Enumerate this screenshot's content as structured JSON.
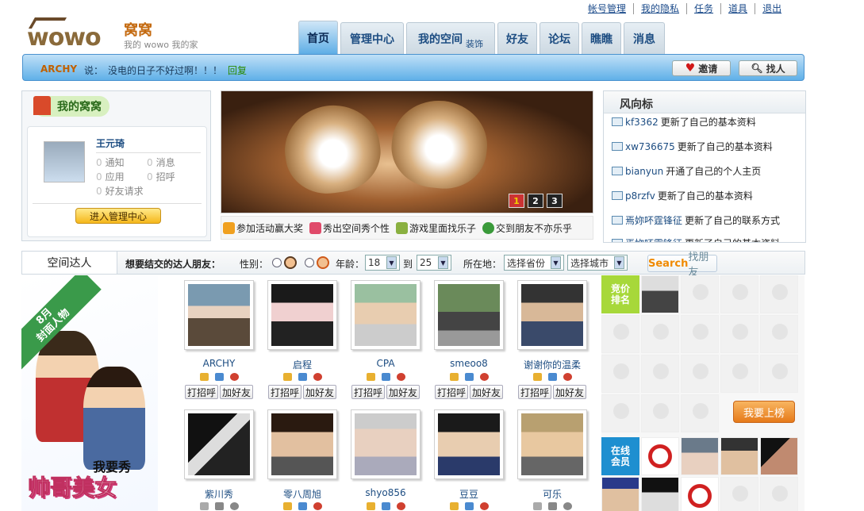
{
  "top_links": [
    "帐号管理",
    "我的隐私",
    "任务",
    "道具",
    "退出"
  ],
  "logo": {
    "mark": "wowo",
    "name": "窝窝",
    "tagline": "我的 wowo 我的家"
  },
  "nav": {
    "tabs": [
      {
        "label": "首页",
        "active": true
      },
      {
        "label": "管理中心"
      },
      {
        "label": "我的空间",
        "sub": "装饰"
      },
      {
        "label": "好友"
      },
      {
        "label": "论坛"
      },
      {
        "label": "瞧瞧"
      },
      {
        "label": "消息"
      }
    ]
  },
  "status": {
    "user": "ARCHY",
    "says": "说：",
    "text": "没电的日子不好过啊！！！",
    "reply": "回复",
    "invite_label": "邀请",
    "find_label": "找人"
  },
  "my_nest": {
    "title": "我的窝窝",
    "username": "王元琦",
    "counters": [
      {
        "count": "0",
        "label": "通知"
      },
      {
        "count": "0",
        "label": "消息"
      },
      {
        "count": "0",
        "label": "应用"
      },
      {
        "count": "0",
        "label": "招呼"
      },
      {
        "count": "0",
        "label": "好友请求"
      }
    ],
    "manage_button": "进入管理中心"
  },
  "banner": {
    "pages": [
      "1",
      "2",
      "3"
    ],
    "active_page": "1",
    "links": [
      "参加活动赢大奖",
      "秀出空间秀个性",
      "游戏里面找乐子",
      "交到朋友不亦乐乎"
    ]
  },
  "feed": {
    "title": "风向标",
    "items": [
      {
        "who": "kf3362",
        "action": "更新了自己的基本资料"
      },
      {
        "who": "xw736675",
        "action": "更新了自己的基本资料"
      },
      {
        "who": "bianyun",
        "action": "开通了自己的个人主页"
      },
      {
        "who": "p8rzfv",
        "action": "更新了自己的基本资料"
      },
      {
        "who": "焉妳吥霆锋征",
        "action": "更新了自己的联系方式"
      },
      {
        "who": "焉妳吥霆锋征",
        "action": "更新了自己的基本资料"
      }
    ]
  },
  "talent": {
    "title": "空间达人",
    "filter_prompt": "想要结交的达人朋友：",
    "gender_label": "性别：",
    "age_label": "年龄：",
    "age_from": "18",
    "age_to_label": "到",
    "age_to": "25",
    "location_label": "所在地：",
    "province": "选择省份",
    "city": "选择城市",
    "search_s": "Search",
    "search_f": "找朋友"
  },
  "promo": {
    "ribbon": "8月\n封面人物",
    "show": "我要秀",
    "big": "帅哥美女"
  },
  "cards_row1": [
    {
      "name": "ARCHY",
      "greet": "打招呼",
      "add": "加好友"
    },
    {
      "name": "启程",
      "greet": "打招呼",
      "add": "加好友"
    },
    {
      "name": "CPA",
      "greet": "打招呼",
      "add": "加好友"
    },
    {
      "name": "smeoo8",
      "greet": "打招呼",
      "add": "加好友"
    },
    {
      "name": "谢谢你的温柔",
      "greet": "打招呼",
      "add": "加好友"
    }
  ],
  "cards_row2": [
    {
      "name": "紫川秀"
    },
    {
      "name": "零八周旭"
    },
    {
      "name": "shyo856"
    },
    {
      "name": "豆豆"
    },
    {
      "name": "可乐"
    }
  ],
  "right_panel": {
    "bid_tag": "竞价\n排名",
    "online_tag": "在线\n会员",
    "rank_button": "我要上榜"
  }
}
